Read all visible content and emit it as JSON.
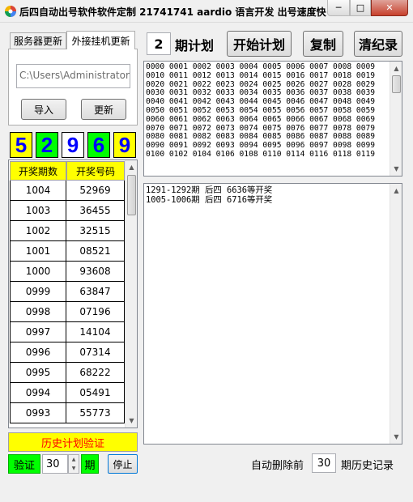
{
  "window": {
    "title": "后四自动出号软件软件定制 21741741 aardio 语言开发 出号速度快 ...",
    "min_glyph": "─",
    "max_glyph": "□",
    "close_glyph": "✕"
  },
  "tabs": [
    {
      "label": "服务器更新"
    },
    {
      "label": "外接挂机更新"
    }
  ],
  "path_field": {
    "value": "C:\\Users\\Administrator\\"
  },
  "buttons": {
    "import": "导入",
    "update": "更新",
    "start_plan": "开始计划",
    "copy": "复制",
    "clear_records": "清纪录",
    "stop": "停止"
  },
  "digits": [
    {
      "value": "5",
      "bg": "#ffff00",
      "color": "#0000ff"
    },
    {
      "value": "2",
      "bg": "#00ff00",
      "color": "#0000ff"
    },
    {
      "value": "9",
      "bg": "#ffffff",
      "color": "#0000ff"
    },
    {
      "value": "6",
      "bg": "#00ff00",
      "color": "#0000ff"
    },
    {
      "value": "9",
      "bg": "#ffff00",
      "color": "#0000ff"
    }
  ],
  "draw_table": {
    "headers": [
      "开奖期数",
      "开奖号码"
    ],
    "rows": [
      [
        "1004",
        "52969"
      ],
      [
        "1003",
        "36455"
      ],
      [
        "1002",
        "32515"
      ],
      [
        "1001",
        "08521"
      ],
      [
        "1000",
        "93608"
      ],
      [
        "0999",
        "63847"
      ],
      [
        "0998",
        "07196"
      ],
      [
        "0997",
        "14104"
      ],
      [
        "0996",
        "07314"
      ],
      [
        "0995",
        "68222"
      ],
      [
        "0994",
        "05491"
      ],
      [
        "0993",
        "55773"
      ]
    ]
  },
  "history_verify_label": "历史计划验证",
  "verify": {
    "label": "验证",
    "value": "30",
    "unit": "期"
  },
  "plan": {
    "count": "2",
    "label": "期计划"
  },
  "number_grid": [
    "0000 0001 0002 0003 0004 0005 0006 0007 0008 0009",
    "0010 0011 0012 0013 0014 0015 0016 0017 0018 0019",
    "0020 0021 0022 0023 0024 0025 0026 0027 0028 0029",
    "0030 0031 0032 0033 0034 0035 0036 0037 0038 0039",
    "0040 0041 0042 0043 0044 0045 0046 0047 0048 0049",
    "0050 0051 0052 0053 0054 0055 0056 0057 0058 0059",
    "0060 0061 0062 0063 0064 0065 0066 0067 0068 0069",
    "0070 0071 0072 0073 0074 0075 0076 0077 0078 0079",
    "0080 0081 0082 0083 0084 0085 0086 0087 0088 0089",
    "0090 0091 0092 0093 0094 0095 0096 0097 0098 0099",
    "0100 0102 0104 0106 0108 0110 0114 0116 0118 0119"
  ],
  "results": [
    "1291-1292期 后四 6636等开奖",
    "1005-1006期 后四 6716等开奖"
  ],
  "auto_delete": {
    "label_before": "自动删除前",
    "value": "30",
    "label_after": "期历史记录"
  }
}
